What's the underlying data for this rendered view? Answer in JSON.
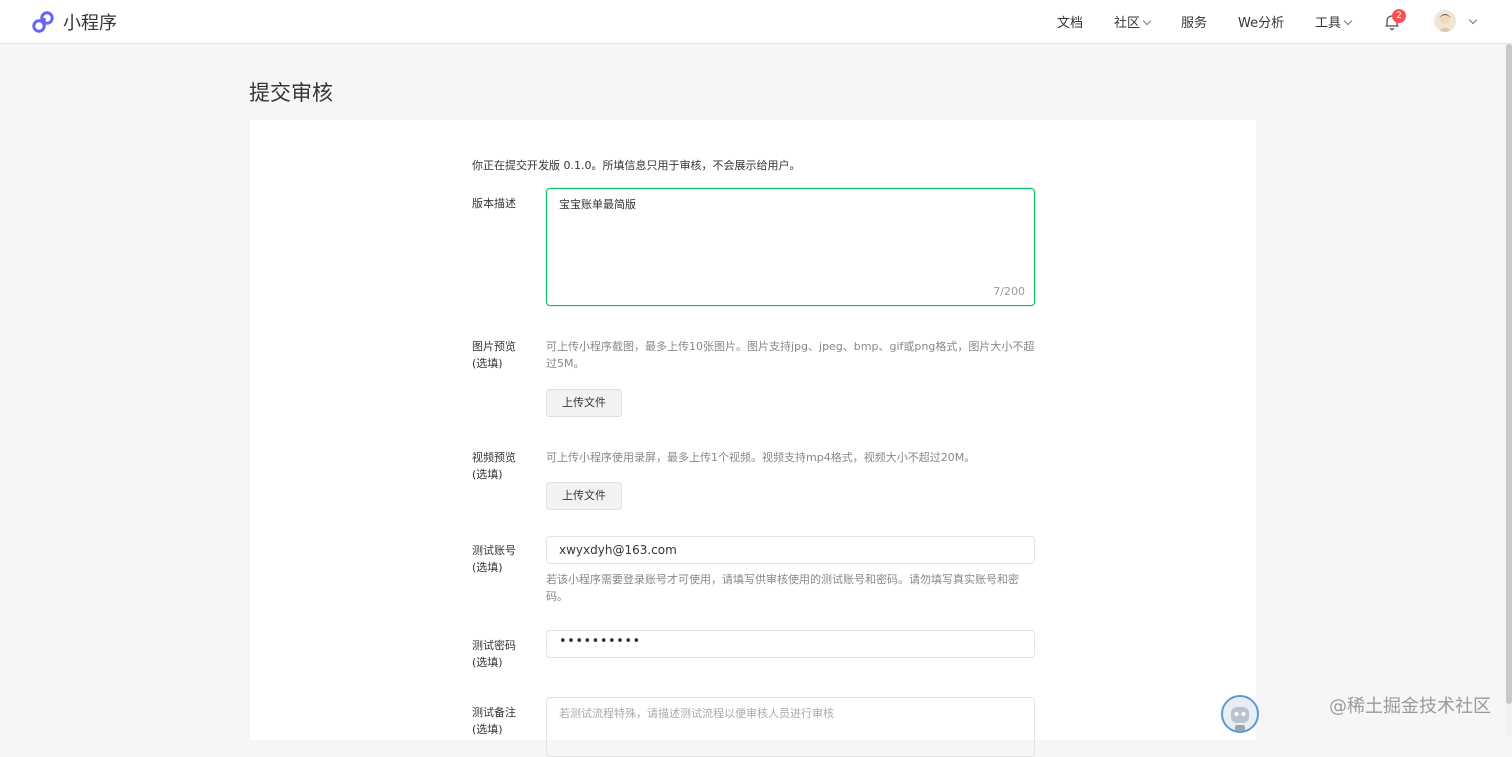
{
  "nav": {
    "brand": "小程序",
    "items": [
      {
        "label": "文档",
        "dropdown": false
      },
      {
        "label": "社区",
        "dropdown": true
      },
      {
        "label": "服务",
        "dropdown": false
      },
      {
        "label": "We分析",
        "dropdown": false
      },
      {
        "label": "工具",
        "dropdown": true
      }
    ],
    "notification_count": "2"
  },
  "page": {
    "title": "提交审核"
  },
  "form": {
    "intro": "你正在提交开发版 0.1.0。所填信息只用于审核，不会展示给用户。",
    "description": {
      "label": "版本描述",
      "value": "宝宝账单最简版",
      "counter": "7/200"
    },
    "image_preview": {
      "label": "图片预览",
      "optional": "(选填)",
      "hint": "可上传小程序截图，最多上传10张图片。图片支持jpg、jpeg、bmp、gif或png格式，图片大小不超过5M。",
      "button": "上传文件"
    },
    "video_preview": {
      "label": "视频预览",
      "optional": "(选填)",
      "hint": "可上传小程序使用录屏，最多上传1个视频。视频支持mp4格式，视频大小不超过20M。",
      "button": "上传文件"
    },
    "test_account": {
      "label": "测试账号",
      "optional": "(选填)",
      "value": "xwyxdyh@163.com",
      "hint": "若该小程序需要登录账号才可使用，请填写供审核使用的测试账号和密码。请勿填写真实账号和密码。"
    },
    "test_password": {
      "label": "测试密码",
      "optional": "(选填)",
      "value": "••••••••••"
    },
    "test_notes": {
      "label": "测试备注",
      "optional": "(选填)",
      "placeholder": "若测试流程特殊，请描述测试流程以便审核人员进行审核"
    }
  },
  "watermark": "@稀土掘金技术社区",
  "colors": {
    "accent": "#07c160",
    "badge": "#fa5151",
    "background": "#f6f6f6"
  }
}
